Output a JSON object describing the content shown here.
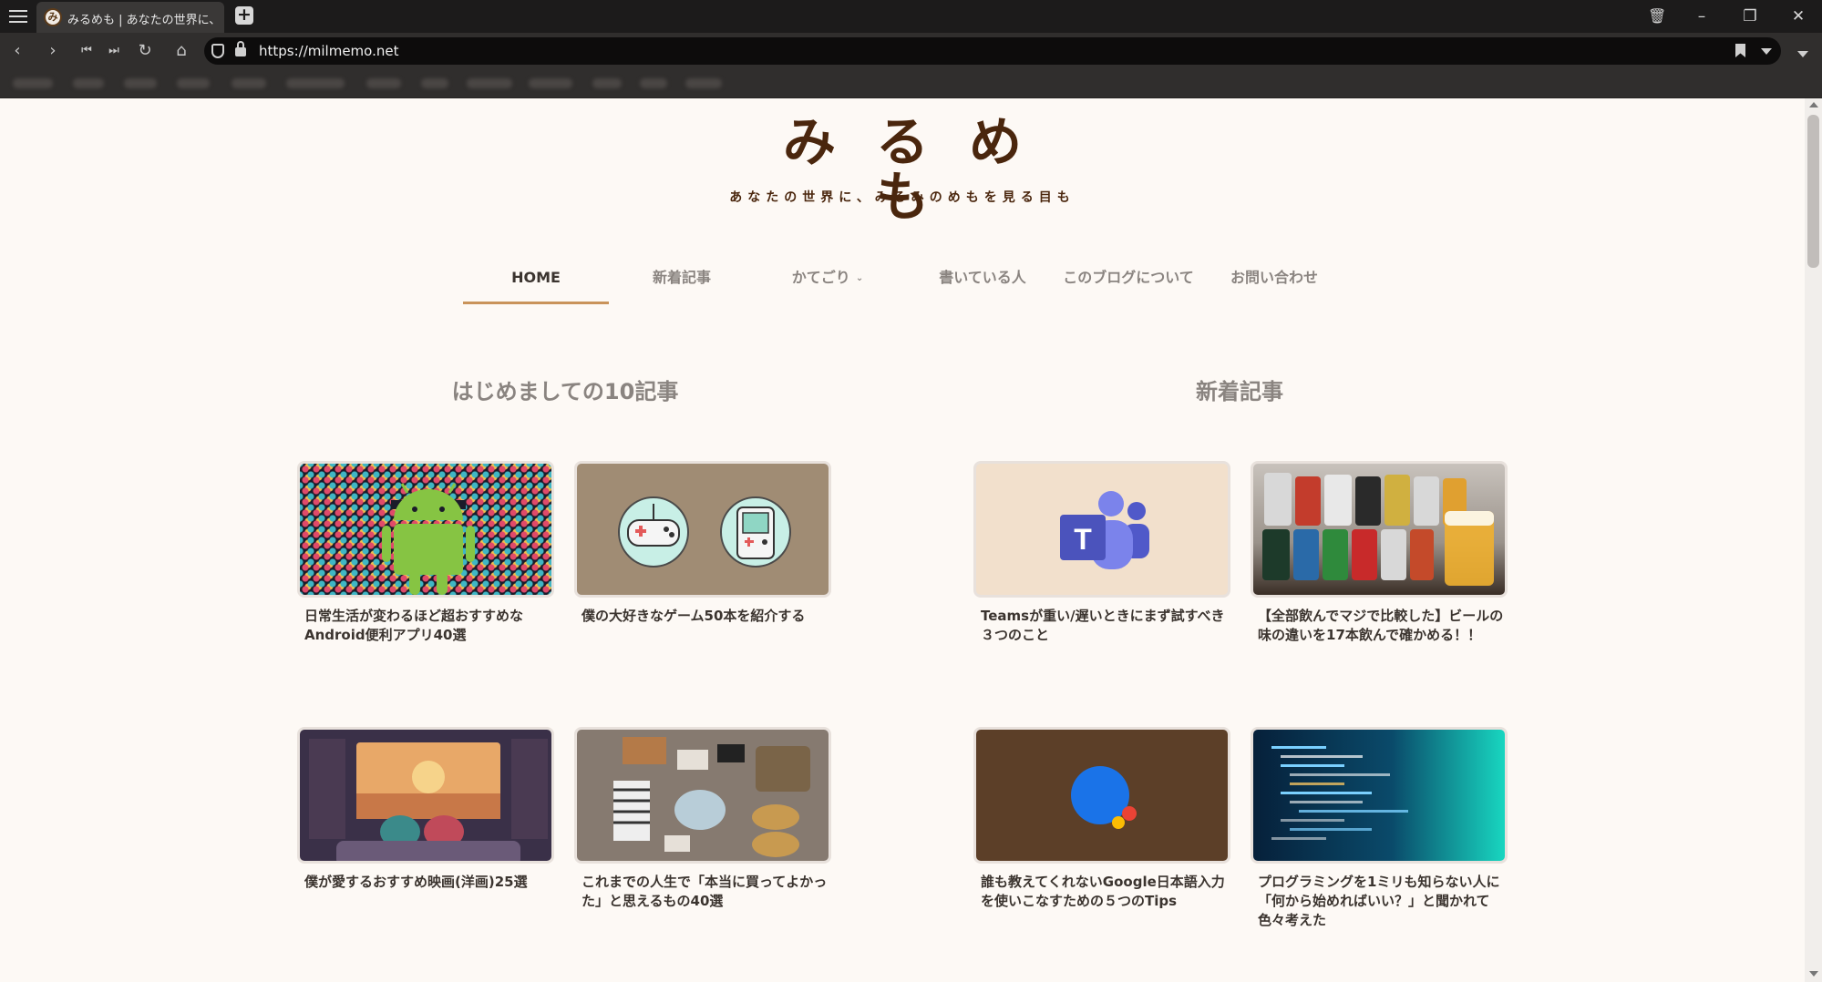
{
  "browser": {
    "tab_title": "みるめも | あなたの世界に、み",
    "url": "https://milmemo.net"
  },
  "site": {
    "logo": "みるめも",
    "tagline": "あなたの世界に、みるみのめもを見る目も"
  },
  "nav": {
    "items": [
      {
        "label": "HOME",
        "active": true
      },
      {
        "label": "新着記事",
        "active": false
      },
      {
        "label": "かてごり",
        "active": false,
        "dropdown": true
      },
      {
        "label": "書いている人",
        "active": false
      },
      {
        "label": "このブログについて",
        "active": false
      },
      {
        "label": "お問い合わせ",
        "active": false
      }
    ]
  },
  "sections": {
    "left_title": "はじめましての10記事",
    "right_title": "新着記事"
  },
  "cards": [
    {
      "title": "日常生活が変わるほど超おすすめなAndroid便利アプリ40選",
      "thumb_icon": "android-icon"
    },
    {
      "title": "僕の大好きなゲーム50本を紹介する",
      "thumb_icon": "gamepad-icon"
    },
    {
      "title": "Teamsが重い/遅いときにまず試すべき３つのこと",
      "thumb_icon": "teams-icon"
    },
    {
      "title": "【全部飲んでマジで比較した】ビールの味の違いを17本飲んで確かめる！！",
      "thumb_icon": "beer-cans-icon"
    },
    {
      "title": "僕が愛するおすすめ映画(洋画)25選",
      "thumb_icon": "movie-icon"
    },
    {
      "title": "これまでの人生で「本当に買ってよかった」と思えるもの40選",
      "thumb_icon": "items-icon"
    },
    {
      "title": "誰も教えてくれないGoogle日本語入力を使いこなすための５つのTips",
      "thumb_icon": "google-ime-icon"
    },
    {
      "title": "プログラミングを1ミリも知らない人に「何から始めればいい？」と聞かれて色々考えた",
      "thumb_icon": "code-icon"
    }
  ]
}
